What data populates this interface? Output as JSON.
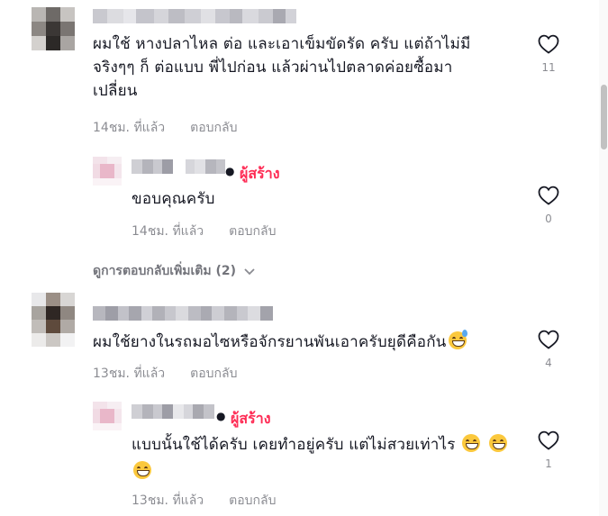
{
  "comments": [
    {
      "text_lines": [
        "ผมใช้ หางปลาไหล ต่อ และเอาเข็มขัดรัด ครับ แต่ถ้าไม่มี",
        "จริงๆๆ ก็ ต่อแบบ พี่ไปก่อน แล้วผ่านไปตลาดค่อยซื้อมา",
        "เปลี่ยน"
      ],
      "time": "14ชม. ที่แล้ว",
      "reply_label": "ตอบกลับ",
      "likes": "11"
    },
    {
      "creator_label": "ผู้สร้าง",
      "text": "ขอบคุณครับ",
      "time": "14ชม. ที่แล้ว",
      "reply_label": "ตอบกลับ",
      "likes": "0"
    },
    {
      "text": "ผมใช้ยางในรถมอไซหรือจักรยานพันเอาครับยุดีคือกัน",
      "time": "13ชม. ที่แล้ว",
      "reply_label": "ตอบกลับ",
      "likes": "4",
      "emoji": "sweat-smile-emoji"
    },
    {
      "creator_label": "ผู้สร้าง",
      "text": "แบบนั้นใช้ได้ครับ เคยทำอยู่ครับ แต่ไม่สวยเท่าไร",
      "time": "13ชม. ที่แล้ว",
      "reply_label": "ตอบกลับ",
      "likes": "1",
      "emoji": "grin-emoji"
    }
  ],
  "more_replies_label": "ดูการตอบกลับเพิ่มเติม (2)",
  "colors": {
    "creator": "#fe2c55",
    "muted": "#8a8b91",
    "text": "#161823"
  }
}
